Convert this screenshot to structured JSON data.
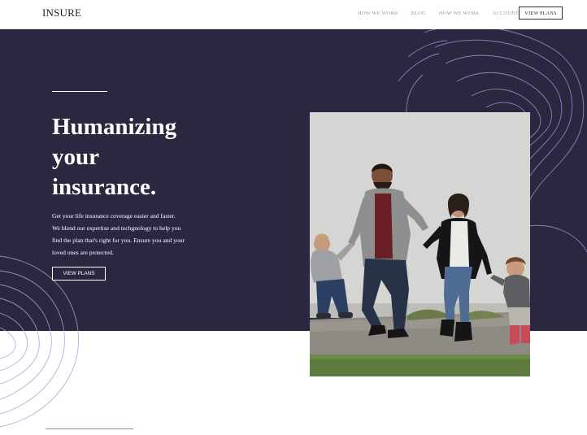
{
  "header": {
    "logo": "INSURE",
    "nav": [
      {
        "label": "HOW WE WORK"
      },
      {
        "label": "BLOG"
      },
      {
        "label": "HOW WE WORK"
      },
      {
        "label": "ACCOUNT"
      }
    ],
    "cta_label": "VIEW PLANS"
  },
  "hero": {
    "title_lines": [
      "Humanizing",
      "your",
      "insurance."
    ],
    "description_lines": [
      "Get your life insurance coverage easier and faster.",
      "We blend our expertise and techgnology to help you",
      "find the plan that's right for you. Ensure you and your",
      "loved ones are protected."
    ],
    "cta_label": "VIEW PLANS",
    "photo_icon": "family-walking-photo"
  },
  "colors": {
    "hero_bg": "#2d2640",
    "accent": "#8e8aa6",
    "text_dark": "#1f1b2f",
    "nav_text": "#9a97ab"
  }
}
